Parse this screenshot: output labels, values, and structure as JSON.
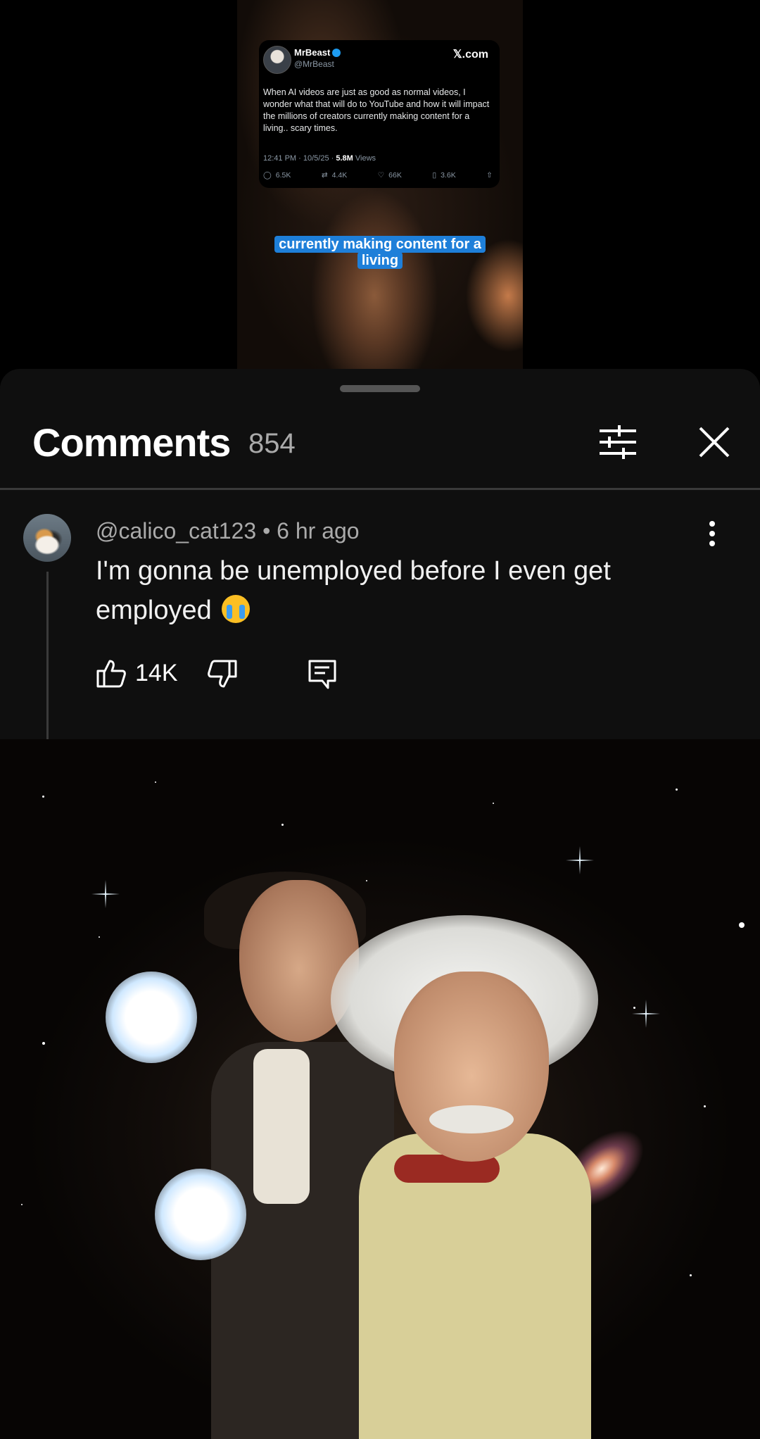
{
  "video": {
    "tweet": {
      "name": "MrBeast",
      "handle": "@MrBeast",
      "site": "𝕏.com",
      "body": "When AI videos are just as good as normal videos, I wonder what that will do to YouTube and how it will impact the millions of creators currently making content for a living.. scary times.",
      "time": "12:41 PM · 10/5/25 · ",
      "views_value": "5.8M",
      "views_label": " Views",
      "replies": "6.5K",
      "reposts": "4.4K",
      "likes": "66K",
      "bookmarks": "3.6K"
    },
    "caption": "currently making content for a living"
  },
  "comments": {
    "title": "Comments",
    "count": "854",
    "items": [
      {
        "author": "@calico_cat123",
        "separator": " • ",
        "age": "6 hr ago",
        "text": "I'm gonna be unemployed before I even get employed",
        "likes": "14K"
      }
    ]
  },
  "icons": [
    "filter-icon",
    "close-icon",
    "more-vert-icon",
    "thumb-up-icon",
    "thumb-down-icon",
    "reply-icon"
  ],
  "colors": {
    "sheet_bg": "#0f0f0f",
    "caption_bg": "#1e7fd9",
    "verified": "#1d9bf0"
  }
}
